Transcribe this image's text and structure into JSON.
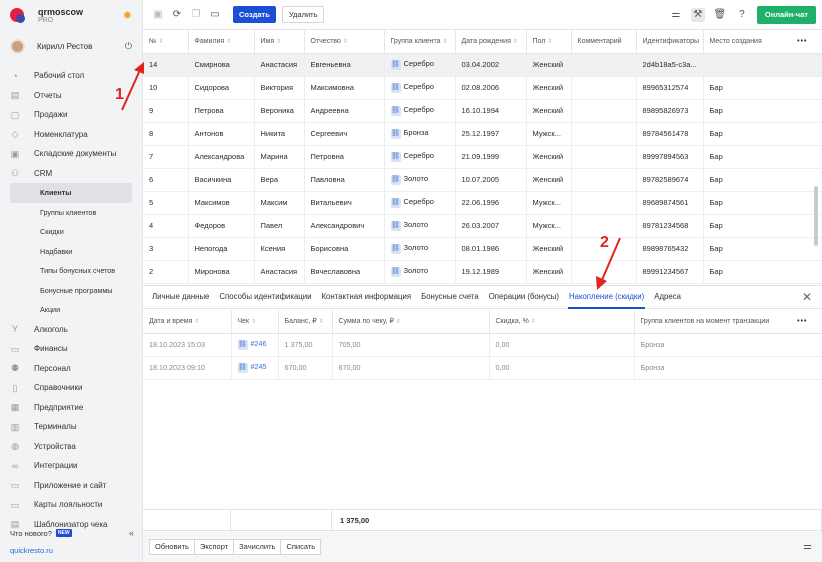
{
  "brand": {
    "name": "qrmoscow",
    "plan": "PRO"
  },
  "user": {
    "name": "Кирилл Рестов"
  },
  "sidebar": {
    "items": [
      {
        "label": "Рабочий стол",
        "icon": "dashboard-icon"
      },
      {
        "label": "Отчеты",
        "icon": "reports-icon"
      },
      {
        "label": "Продажи",
        "icon": "sales-icon"
      },
      {
        "label": "Номенклатура",
        "icon": "tag-icon"
      },
      {
        "label": "Складские документы",
        "icon": "warehouse-icon"
      },
      {
        "label": "CRM",
        "icon": "crm-icon"
      }
    ],
    "crm_sub": [
      "Клиенты",
      "Группы клиентов",
      "Скидки",
      "Надбавки",
      "Типы бонусных счетов",
      "Бонусные программы",
      "Акции"
    ],
    "items2": [
      {
        "label": "Алкоголь",
        "icon": "alcohol-icon"
      },
      {
        "label": "Финансы",
        "icon": "finance-icon"
      },
      {
        "label": "Персонал",
        "icon": "staff-icon"
      },
      {
        "label": "Справочники",
        "icon": "book-icon"
      },
      {
        "label": "Предприятие",
        "icon": "enterprise-icon"
      },
      {
        "label": "Терминалы",
        "icon": "terminal-icon"
      },
      {
        "label": "Устройства",
        "icon": "device-icon"
      },
      {
        "label": "Интеграции",
        "icon": "integration-icon"
      },
      {
        "label": "Приложение и сайт",
        "icon": "app-icon"
      },
      {
        "label": "Карты лояльности",
        "icon": "card-icon"
      },
      {
        "label": "Шаблонизатор чека",
        "icon": "receipt-icon"
      }
    ],
    "whats_new": "Что нового?",
    "new_badge": "NEW",
    "site": "quickresto.ru"
  },
  "toolbar": {
    "create": "Создать",
    "delete": "Удалить",
    "chat": "Онлайн-чат"
  },
  "clients": {
    "columns": [
      "№",
      "Фамилия",
      "Имя",
      "Отчество",
      "Группа клиента",
      "Дата рождения",
      "Пол",
      "Комментарий",
      "Идентификаторы",
      "Место создания"
    ],
    "rows": [
      [
        "14",
        "Смирнова",
        "Анастасия",
        "Евгеньевна",
        "Серебро",
        "03.04.2002",
        "Женский",
        "",
        "2d4b18a5-c3a...",
        ""
      ],
      [
        "10",
        "Сидорова",
        "Виктория",
        "Максимовна",
        "Серебро",
        "02.08.2006",
        "Женский",
        "",
        "89965312574",
        "Бар"
      ],
      [
        "9",
        "Петрова",
        "Вероника",
        "Андреевна",
        "Серебро",
        "16.10.1994",
        "Женский",
        "",
        "89895826973",
        "Бар"
      ],
      [
        "8",
        "Антонов",
        "Никита",
        "Сергеевич",
        "Бронза",
        "25.12.1997",
        "Мужск...",
        "",
        "89784561478",
        "Бар"
      ],
      [
        "7",
        "Александрова",
        "Марина",
        "Петровна",
        "Серебро",
        "21.09.1999",
        "Женский",
        "",
        "89997894563",
        "Бар"
      ],
      [
        "6",
        "Васичкина",
        "Вера",
        "Павловна",
        "Золото",
        "10.07.2005",
        "Женский",
        "",
        "89782589674",
        "Бар"
      ],
      [
        "5",
        "Максимов",
        "Максим",
        "Витальевич",
        "Серебро",
        "22.06.1996",
        "Мужск...",
        "",
        "89689874561",
        "Бар"
      ],
      [
        "4",
        "Федоров",
        "Павел",
        "Александрович",
        "Золото",
        "26.03.2007",
        "Мужск...",
        "",
        "89781234568",
        "Бар"
      ],
      [
        "3",
        "Непогода",
        "Ксения",
        "Борисовна",
        "Золото",
        "08.01.1986",
        "Женский",
        "",
        "89898765432",
        "Бар"
      ],
      [
        "2",
        "Миронова",
        "Анастасия",
        "Вячеславовна",
        "Золото",
        "19.12.1989",
        "Женский",
        "",
        "89991234567",
        "Бар"
      ]
    ]
  },
  "tabs": [
    "Личные данные",
    "Способы идентификации",
    "Контактная информация",
    "Бонусные счета",
    "Операции (бонусы)",
    "Накопление (скидки)",
    "Адреса"
  ],
  "accum": {
    "columns": [
      "Дата и время",
      "Чек",
      "Баланс, ₽",
      "Сумма по чеку, ₽",
      "Скидка, %",
      "Группа клиентов на момент транзакции"
    ],
    "rows": [
      [
        "18.10.2023 15:03",
        "#246",
        "1 375,00",
        "705,00",
        "0,00",
        "Бронза"
      ],
      [
        "18.10.2023 09:10",
        "#245",
        "670,00",
        "670,00",
        "0,00",
        "Бронза"
      ]
    ],
    "total": "1 375,00"
  },
  "bottom": {
    "update": "Обновить",
    "export": "Экспорт",
    "accrue": "Зачислить",
    "writeoff": "Списать"
  },
  "annotations": {
    "one": "1",
    "two": "2"
  },
  "colors": {
    "accent": "#1c4fd6",
    "chat": "#1fb06a",
    "annotation": "#e0241f"
  }
}
